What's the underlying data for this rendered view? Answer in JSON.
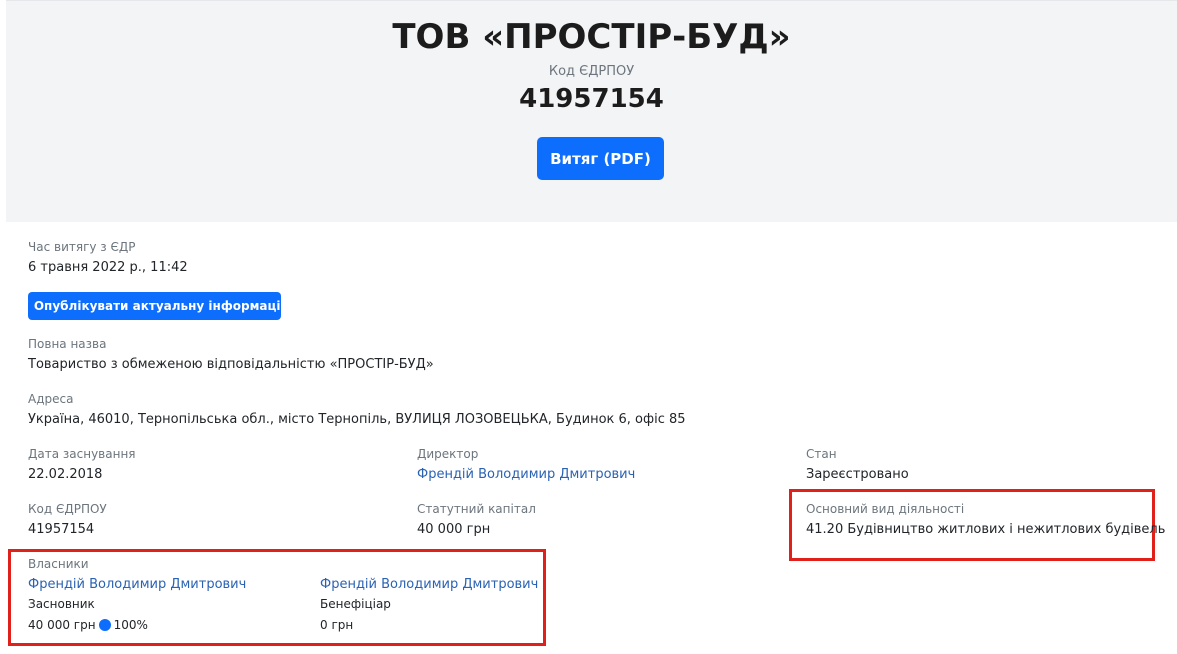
{
  "company": {
    "title": "ТОВ «ПРОСТІР-БУД»",
    "code_label": "Код ЄДРПОУ",
    "code_value": "41957154",
    "pdf_button": "Витяг (PDF)"
  },
  "extract": {
    "time_label": "Час витягу з ЄДР",
    "time_value": "6 травня 2022 р., 11:42",
    "publish_button": "Опублікувати актуальну інформацію",
    "publish_icon": "refresh-icon"
  },
  "details": {
    "full_name_label": "Повна назва",
    "full_name_value": "Товариство з обмеженою відповідальністю «ПРОСТІР-БУД»",
    "address_label": "Адреса",
    "address_value": "Україна, 46010, Тернопільська обл., місто Тернопіль, ВУЛИЦЯ ЛОЗОВЕЦЬКА, Будинок 6, офіс 85",
    "founded_label": "Дата заснування",
    "founded_value": "22.02.2018",
    "director_label": "Директор",
    "director_value": "Френдій Володимир Дмитрович",
    "status_label": "Стан",
    "status_value": "Зареєстровано",
    "code_label": "Код ЄДРПОУ",
    "code_value": "41957154",
    "capital_label": "Статутний капітал",
    "capital_value": "40 000 грн",
    "activity_label": "Основний вид діяльності",
    "activity_value": "41.20 Будівництво житлових і нежитлових будівель"
  },
  "owners": {
    "label": "Власники",
    "items": [
      {
        "name": "Френдій Володимир Дмитрович",
        "role": "Засновник",
        "amount": "40 000 грн",
        "share": "100%"
      },
      {
        "name": "Френдій Володимир Дмитрович",
        "role": "Бенефіціар",
        "amount": "0 грн"
      }
    ]
  },
  "colors": {
    "accent": "#0d6efd",
    "link": "#2a62b3",
    "highlight": "#e0201b",
    "header_bg": "#f3f4f6"
  }
}
